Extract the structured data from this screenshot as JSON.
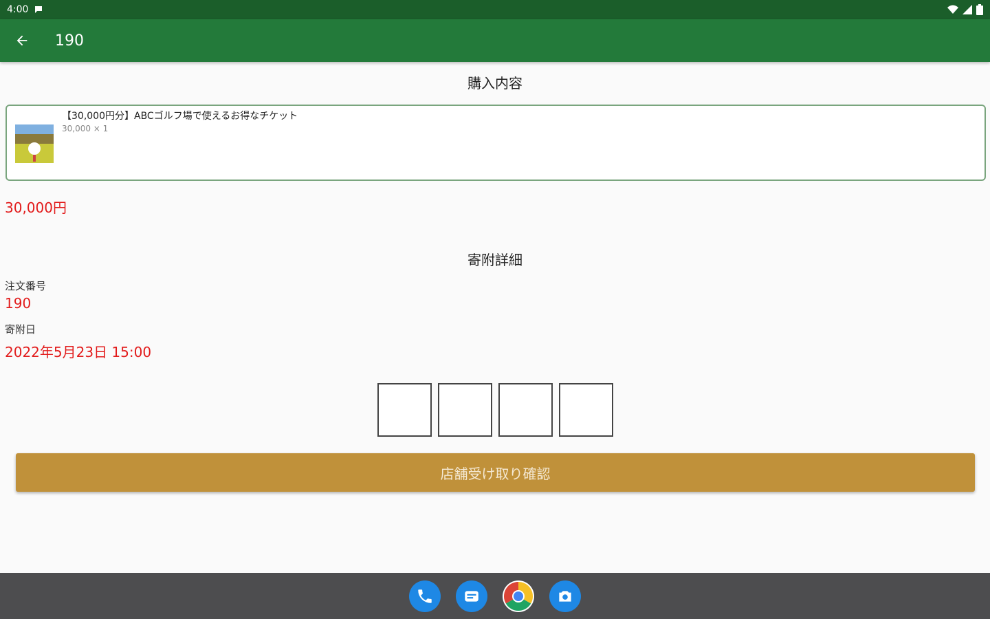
{
  "status_bar": {
    "time": "4:00"
  },
  "app_bar": {
    "title": "190"
  },
  "purchase": {
    "section_title": "購入内容",
    "item": {
      "name": "【30,000円分】ABCゴルフ場で使えるお得なチケット",
      "price_qty": "30,000 × 1"
    },
    "total": "30,000円"
  },
  "donation": {
    "section_title": "寄附詳細",
    "order_label": "注文番号",
    "order_value": "190",
    "date_label": "寄附日",
    "date_value": "2022年5月23日 15:00"
  },
  "code_input": {
    "boxes": [
      "",
      "",
      "",
      ""
    ]
  },
  "confirm_button": {
    "label": "店舗受け取り確認"
  },
  "dock": {
    "icons": [
      "phone-icon",
      "messages-icon",
      "chrome-icon",
      "camera-icon"
    ]
  },
  "colors": {
    "status_bar": "#1b5e2a",
    "app_bar": "#237a3a",
    "accent_red": "#e21b1b",
    "button": "#c0913a",
    "card_border": "#7aa57e",
    "nav_bar": "#4d4d4f"
  }
}
